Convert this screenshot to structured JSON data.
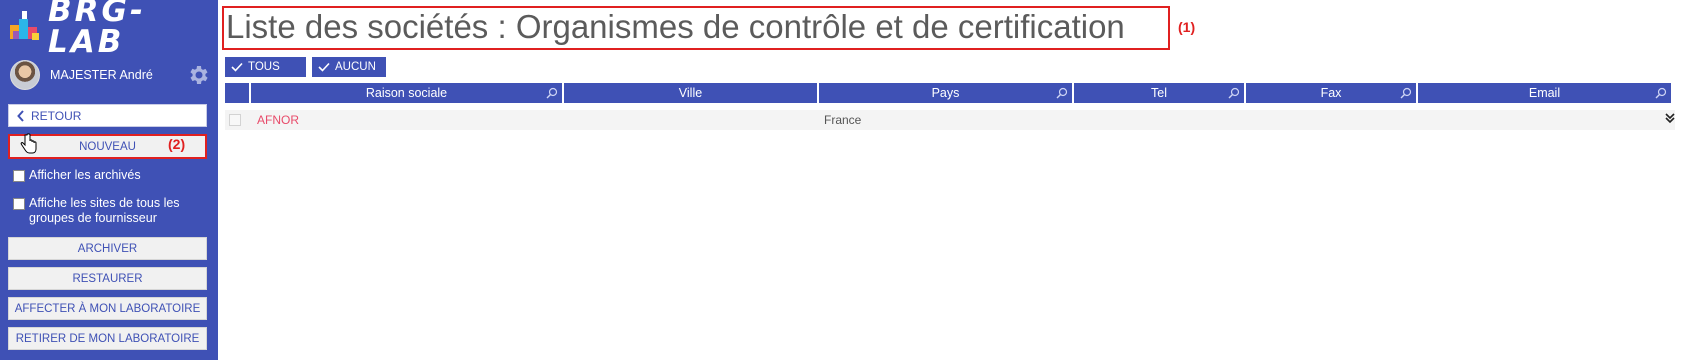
{
  "app": {
    "logo_text": "BRG-LAB"
  },
  "user": {
    "name": "MAJESTER André"
  },
  "sidebar": {
    "retour_label": "RETOUR",
    "nouveau_label": "NOUVEAU",
    "nouveau_callout": "(2)",
    "checkbox_archives": "Afficher les archivés",
    "checkbox_sites_line1": "Affiche les sites de tous les",
    "checkbox_sites_line2": "groupes de fournisseur",
    "buttons": [
      "ARCHIVER",
      "RESTAURER",
      "AFFECTER À MON LABORATOIRE",
      "RETIRER DE MON LABORATOIRE"
    ]
  },
  "main": {
    "title": "Liste des sociétés : Organismes de contrôle et de certification",
    "title_callout": "(1)",
    "tous_label": "TOUS",
    "aucun_label": "AUCUN",
    "columns": [
      "Raison sociale",
      "Ville",
      "Pays",
      "Tel",
      "Fax",
      "Email"
    ],
    "rows": [
      {
        "raison_sociale": "AFNOR",
        "ville": "",
        "pays": "France",
        "tel": "",
        "fax": "",
        "email": ""
      }
    ]
  },
  "colors": {
    "primary": "#3f51b5",
    "callout": "#e02020",
    "link": "#e84b6a"
  },
  "icons": [
    "logo-icon",
    "avatar",
    "gear-icon",
    "chevron-left-icon",
    "hand-pointer-icon",
    "check-icon",
    "search-icon",
    "double-chevron-down-icon"
  ]
}
